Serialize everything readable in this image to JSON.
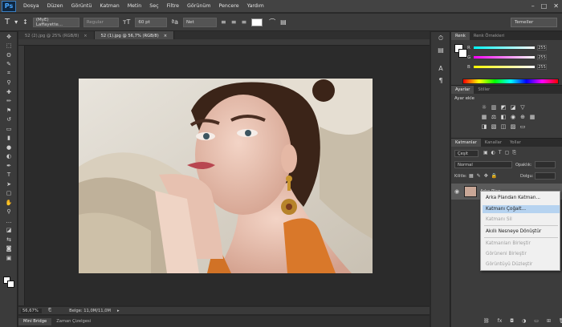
{
  "app": {
    "logo": "Ps"
  },
  "menubar": {
    "items": [
      "Dosya",
      "Düzen",
      "Görüntü",
      "Katman",
      "Metin",
      "Seç",
      "Filtre",
      "Görünüm",
      "Pencere",
      "Yardım"
    ]
  },
  "options": {
    "font_family": "(MyE) Laffayette...",
    "font_style": "Regular",
    "font_size": "60 pt",
    "antialias": "Net",
    "workspace": "Temeller"
  },
  "doc_tabs": [
    {
      "label": "52 (2).jpg @ 25% (RGB/8)",
      "active": false
    },
    {
      "label": "52 (1).jpg @ 56,7% (RGB/8)",
      "active": true
    }
  ],
  "status": {
    "zoom": "56,67%",
    "doc_info": "Belge: 11,0M/11,0M"
  },
  "bottom_tabs": [
    "Mini Bridge",
    "Zaman Çizelgesi"
  ],
  "color_panel": {
    "tabs": [
      "Renk",
      "Renk Örnekleri"
    ],
    "channels": [
      {
        "label": "R",
        "value": "255"
      },
      {
        "label": "G",
        "value": "255"
      },
      {
        "label": "B",
        "value": "255"
      }
    ]
  },
  "adjust_panel": {
    "tabs": [
      "Ayarlar",
      "Stiller"
    ],
    "title": "Ayar ekle"
  },
  "layers_panel": {
    "tabs": [
      "Katmanlar",
      "Kanallar",
      "Yollar"
    ],
    "filter": "Çeşit",
    "blend_mode": "Normal",
    "opacity_label": "Opaklık:",
    "lock_label": "Kilitle:",
    "fill_label": "Dolgu:",
    "layer_name": "Arka Plan"
  },
  "context_menu": {
    "items": [
      {
        "label": "Arka Plandan Katman...",
        "disabled": false,
        "highlight": false
      },
      {
        "label": "Katmanı Çoğalt...",
        "disabled": false,
        "highlight": true
      },
      {
        "label": "Katmanı Sil",
        "disabled": true,
        "highlight": false
      },
      {
        "label": "Akıllı Nesneye Dönüştür",
        "disabled": false,
        "highlight": false
      },
      {
        "label": "Katmanları Birleştir",
        "disabled": true,
        "highlight": false
      },
      {
        "label": "Görüneni Birleştir",
        "disabled": true,
        "highlight": false
      },
      {
        "label": "Görüntüyü Düzleştir",
        "disabled": true,
        "highlight": false
      }
    ]
  },
  "colors": {
    "accent_blue": "#48a7ff",
    "highlight": "#b6d3f0",
    "panel_bg": "#3c3c3c"
  }
}
